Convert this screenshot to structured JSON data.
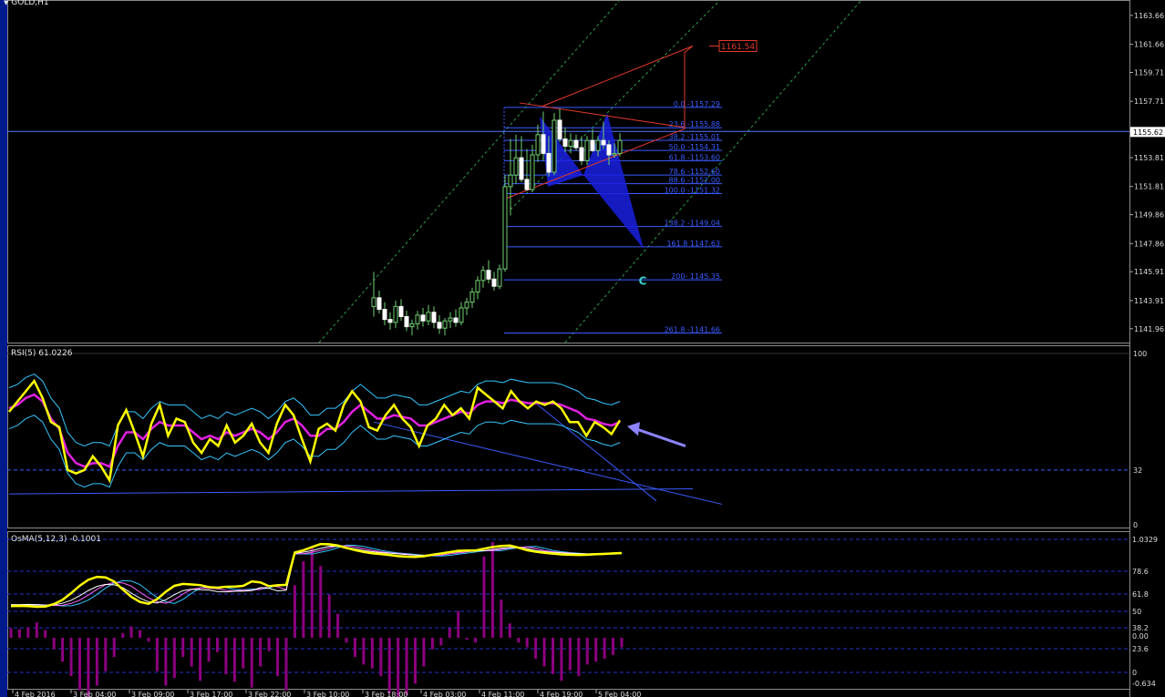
{
  "window": {
    "symbol_title": "GOLD,H1",
    "menu_arrow_icon": "triangle-down-icon"
  },
  "colors": {
    "background": "#000000",
    "bull": "#6fd06f",
    "bear": "#ffffff",
    "fib": "#3b5bff",
    "pattern_fill": "#1a20e0",
    "channel": "#2e9e4a",
    "projection": "#e23a2a",
    "rsi": "#ffff00",
    "rsi_ma": "#e020e0",
    "bands": "#35c6ff",
    "osma_hist": "#8c007f",
    "price_line": "#5577ff",
    "arrow": "#8c84ff"
  },
  "price_panel": {
    "y_ticks": [
      "1163.66",
      "1161.66",
      "1159.71",
      "1157.71",
      "1155.62",
      "1153.81",
      "1151.81",
      "1149.86",
      "1147.86",
      "1145.91",
      "1143.91",
      "1141.96"
    ],
    "current_price": "1155.62",
    "projection_label": "1161.54",
    "point_label": "C",
    "fib_levels": [
      {
        "text": "0.0 -1157.29"
      },
      {
        "text": "23.6 -1155.88"
      },
      {
        "text": "38.2 -1155.01"
      },
      {
        "text": "50.0 -1154.31"
      },
      {
        "text": "61.8 -1153.60"
      },
      {
        "text": "78.6 -1152.60"
      },
      {
        "text": "88.6 -1152.00"
      },
      {
        "text": "100.0 -1151.32"
      },
      {
        "text": "138.2 -1149.04"
      },
      {
        "text": "161.8 1147.63"
      },
      {
        "text": "200- 1145.35"
      },
      {
        "text": "261.8 -1141.66"
      }
    ]
  },
  "rsi_panel": {
    "title": "RSI(5) 61.0226",
    "y_ticks": [
      "100",
      "32",
      "0"
    ]
  },
  "osma_panel": {
    "title": "OsMA(5,12,3) -0.1001",
    "y_ticks": [
      "1.0329",
      "78.6",
      "61.8",
      "50",
      "38.2",
      "0.00",
      "23.6",
      "0",
      "-0.634"
    ]
  },
  "time_axis": {
    "labels": [
      "4 Feb 2016",
      "3 Feb 04:00",
      "3 Feb 09:00",
      "3 Feb 17:00",
      "3 Feb 22:00",
      "3 Feb 10:00",
      "3 Feb 18:00",
      "4 Feb 03:00",
      "4 Feb 11:00",
      "4 Feb 19:00",
      "5 Feb 04:00"
    ]
  },
  "chart_data": [
    {
      "type": "candlestick",
      "title": "GOLD,H1",
      "ylim": [
        1141.0,
        1164.6
      ],
      "ohlc": [
        [
          1143.5,
          1145.9,
          1142.8,
          1144.1
        ],
        [
          1144.1,
          1144.6,
          1143.0,
          1143.3
        ],
        [
          1143.3,
          1143.8,
          1142.2,
          1142.6
        ],
        [
          1142.6,
          1143.1,
          1141.9,
          1142.4
        ],
        [
          1142.4,
          1143.9,
          1142.0,
          1143.5
        ],
        [
          1143.5,
          1144.0,
          1142.5,
          1142.8
        ],
        [
          1142.8,
          1143.2,
          1141.8,
          1142.1
        ],
        [
          1142.1,
          1142.6,
          1141.5,
          1142.3
        ],
        [
          1142.3,
          1143.2,
          1141.9,
          1142.9
        ],
        [
          1142.9,
          1143.4,
          1142.1,
          1142.5
        ],
        [
          1142.5,
          1143.6,
          1142.2,
          1143.1
        ],
        [
          1143.1,
          1143.5,
          1142.0,
          1142.4
        ],
        [
          1142.4,
          1142.9,
          1141.6,
          1142.0
        ],
        [
          1142.0,
          1142.7,
          1141.5,
          1142.5
        ],
        [
          1142.5,
          1143.1,
          1142.0,
          1142.7
        ],
        [
          1142.7,
          1143.3,
          1142.1,
          1142.4
        ],
        [
          1142.4,
          1143.8,
          1142.2,
          1143.4
        ],
        [
          1143.4,
          1144.1,
          1142.9,
          1143.8
        ],
        [
          1143.8,
          1144.8,
          1143.4,
          1144.5
        ],
        [
          1144.5,
          1145.6,
          1144.0,
          1145.3
        ],
        [
          1145.3,
          1146.3,
          1144.8,
          1146.0
        ],
        [
          1146.0,
          1146.7,
          1145.1,
          1145.4
        ],
        [
          1145.4,
          1145.9,
          1144.6,
          1144.9
        ],
        [
          1144.9,
          1146.4,
          1144.7,
          1146.1
        ],
        [
          1146.1,
          1152.6,
          1145.9,
          1151.8
        ],
        [
          1151.8,
          1155.1,
          1149.8,
          1152.6
        ],
        [
          1152.6,
          1155.4,
          1152.0,
          1153.8
        ],
        [
          1153.8,
          1155.3,
          1152.1,
          1152.3
        ],
        [
          1152.3,
          1154.4,
          1151.5,
          1151.6
        ],
        [
          1151.6,
          1154.7,
          1151.4,
          1154.0
        ],
        [
          1154.0,
          1156.1,
          1153.5,
          1155.4
        ],
        [
          1155.4,
          1157.0,
          1153.6,
          1154.1
        ],
        [
          1154.1,
          1155.3,
          1152.5,
          1152.8
        ],
        [
          1152.8,
          1156.9,
          1152.6,
          1156.4
        ],
        [
          1156.4,
          1157.2,
          1154.9,
          1155.1
        ],
        [
          1155.1,
          1155.9,
          1154.2,
          1154.6
        ],
        [
          1154.6,
          1155.5,
          1154.1,
          1155.0
        ],
        [
          1155.0,
          1155.4,
          1154.3,
          1154.5
        ],
        [
          1154.5,
          1155.3,
          1153.3,
          1153.6
        ],
        [
          1153.6,
          1155.3,
          1153.3,
          1155.0
        ],
        [
          1155.0,
          1155.8,
          1154.2,
          1154.3
        ],
        [
          1154.3,
          1155.3,
          1153.9,
          1155.0
        ],
        [
          1155.0,
          1156.3,
          1154.4,
          1154.7
        ],
        [
          1154.7,
          1155.0,
          1153.3,
          1154.0
        ],
        [
          1154.0,
          1154.8,
          1153.8,
          1154.1
        ],
        [
          1154.1,
          1155.5,
          1153.9,
          1155.0
        ]
      ],
      "fib_retracement": [
        1157.29,
        1155.88,
        1155.01,
        1154.31,
        1153.6,
        1152.6,
        1152.0,
        1151.32,
        1149.04,
        1147.63,
        1145.35,
        1141.66
      ],
      "horizontal_line": 1155.62,
      "projection_target": 1161.54
    },
    {
      "type": "line",
      "title": "RSI(5) 61.0226",
      "ylim": [
        0,
        100
      ],
      "series": [
        {
          "name": "RSI(5)",
          "values": [
            66,
            72,
            78,
            84,
            74,
            60,
            57,
            32,
            30,
            32,
            40,
            34,
            26,
            58,
            67,
            54,
            40,
            59,
            70,
            52,
            62,
            60,
            48,
            42,
            50,
            46,
            58,
            48,
            52,
            59,
            48,
            42,
            59,
            70,
            64,
            50,
            37,
            56,
            59,
            55,
            70,
            78,
            72,
            57,
            55,
            64,
            70,
            62,
            57,
            46,
            58,
            62,
            70,
            64,
            68,
            62,
            80,
            76,
            72,
            68,
            78,
            72,
            68,
            72,
            70,
            72,
            68,
            60,
            60,
            52,
            60,
            57,
            53,
            61
          ]
        },
        {
          "name": "",
          "values": [
            68,
            70,
            74,
            76,
            72,
            62,
            56,
            42,
            36,
            34,
            36,
            36,
            34,
            46,
            54,
            54,
            50,
            56,
            60,
            58,
            58,
            58,
            54,
            50,
            52,
            50,
            54,
            52,
            54,
            56,
            54,
            50,
            54,
            60,
            62,
            58,
            52,
            52,
            56,
            56,
            60,
            66,
            70,
            66,
            62,
            62,
            64,
            63,
            62,
            58,
            58,
            60,
            62,
            64,
            66,
            65,
            70,
            72,
            72,
            71,
            73,
            72,
            71,
            71,
            71,
            71,
            70,
            68,
            66,
            62,
            61,
            59,
            58,
            60
          ]
        }
      ]
    },
    {
      "type": "bar",
      "title": "OsMA(5,12,3) -0.1001",
      "series": [
        {
          "name": "OsMA(5,12,3)",
          "values": [
            0.1,
            0.09,
            0.11,
            0.16,
            0.08,
            -0.12,
            -0.25,
            -0.4,
            -0.55,
            -0.62,
            -0.5,
            -0.35,
            -0.2,
            0.05,
            0.12,
            0.08,
            -0.04,
            -0.35,
            -0.5,
            -0.42,
            -0.2,
            -0.3,
            -0.45,
            -0.25,
            -0.15,
            -0.38,
            -0.46,
            -0.32,
            -0.52,
            -0.3,
            -0.14,
            -0.4,
            -0.55,
            0.55,
            0.8,
            0.95,
            0.75,
            0.45,
            0.25,
            -0.05,
            -0.2,
            -0.28,
            -0.32,
            -0.4,
            -0.58,
            -0.75,
            -0.6,
            -0.48,
            -0.3,
            -0.12,
            -0.08,
            0.1,
            0.28,
            -0.02,
            -0.05,
            0.85,
            1.0,
            0.4,
            0.15,
            -0.05,
            -0.1,
            -0.22,
            -0.3,
            -0.38,
            -0.45,
            -0.34,
            -0.4,
            -0.28,
            -0.25,
            -0.22,
            -0.18,
            -0.1
          ]
        }
      ]
    }
  ]
}
